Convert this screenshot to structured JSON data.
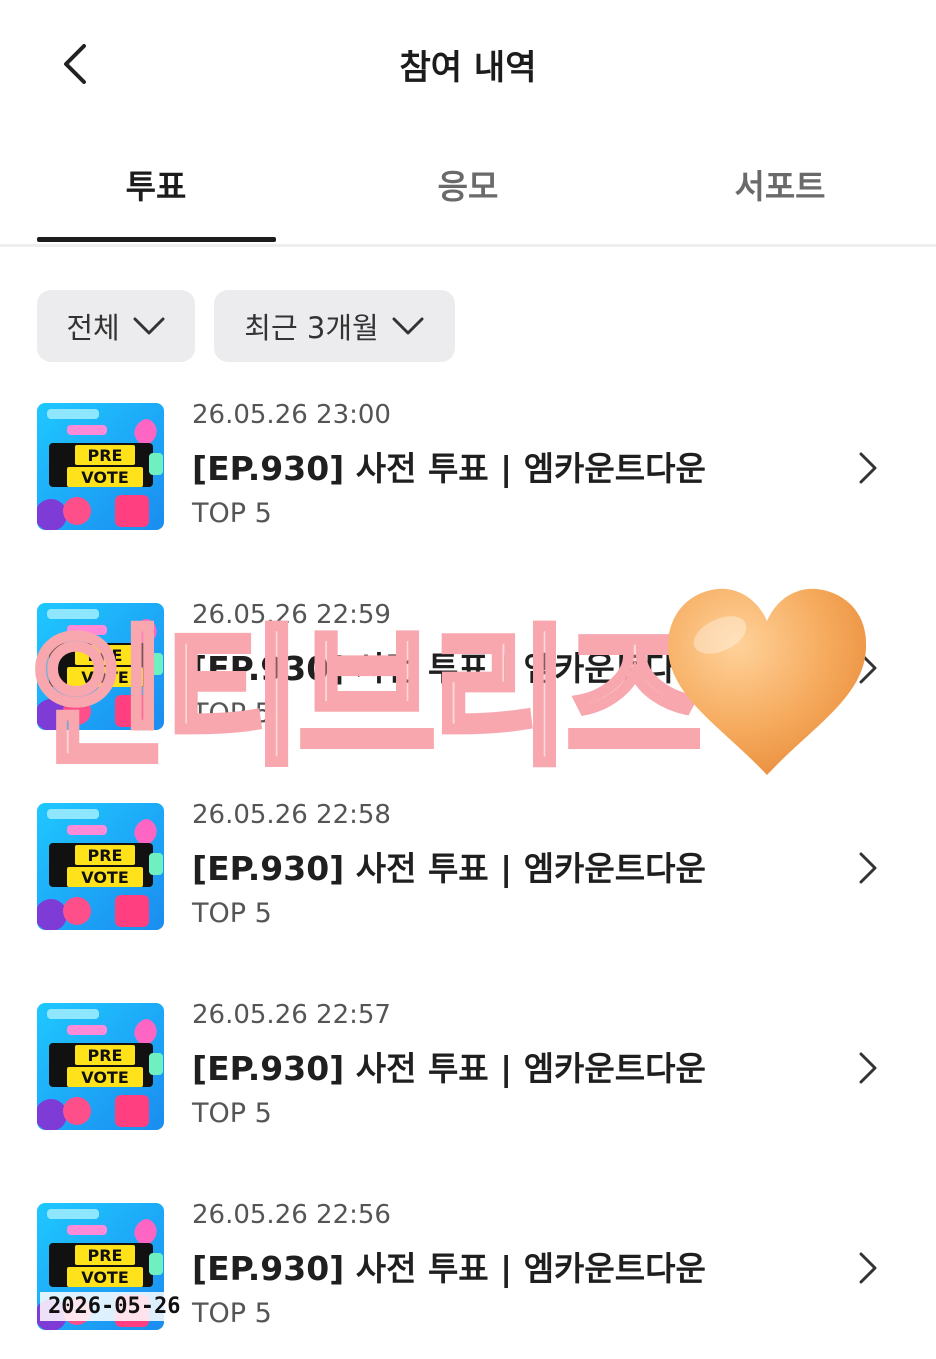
{
  "header": {
    "title": "참여 내역",
    "back_icon": "chevron-left-icon"
  },
  "tabs": [
    {
      "label": "투표",
      "active": true
    },
    {
      "label": "응모",
      "active": false
    },
    {
      "label": "서포트",
      "active": false
    }
  ],
  "filters": {
    "category": {
      "label": "전체",
      "icon": "chevron-down-icon"
    },
    "period": {
      "label": "최근 3개월",
      "icon": "chevron-down-icon"
    }
  },
  "thumbnail": {
    "line1": "PRE",
    "line2": "VOTE"
  },
  "items": [
    {
      "date": "26.05.26 23:00",
      "title": "[EP.930] 사전 투표 | 엠카운트다운",
      "subtitle": "TOP 5"
    },
    {
      "date": "26.05.26 22:59",
      "title": "[EP.930] 사전 투표 | 엠카운트다운",
      "subtitle": "TOP 5"
    },
    {
      "date": "26.05.26 22:58",
      "title": "[EP.930] 사전 투표 | 엠카운트다운",
      "subtitle": "TOP 5"
    },
    {
      "date": "26.05.26 22:57",
      "title": "[EP.930] 사전 투표 | 엠카운트다운",
      "subtitle": "TOP 5"
    },
    {
      "date": "26.05.26 22:56",
      "title": "[EP.930] 사전 투표 | 엠카운트다운",
      "subtitle": "TOP 5"
    }
  ],
  "watermark": {
    "text": "인티브리즈",
    "color": "#f7a7ad"
  },
  "overlay": {
    "heart_icon": "orange-heart-icon",
    "heart_color": "#f5a85a"
  },
  "stamp": {
    "date": "2026-05-26"
  }
}
